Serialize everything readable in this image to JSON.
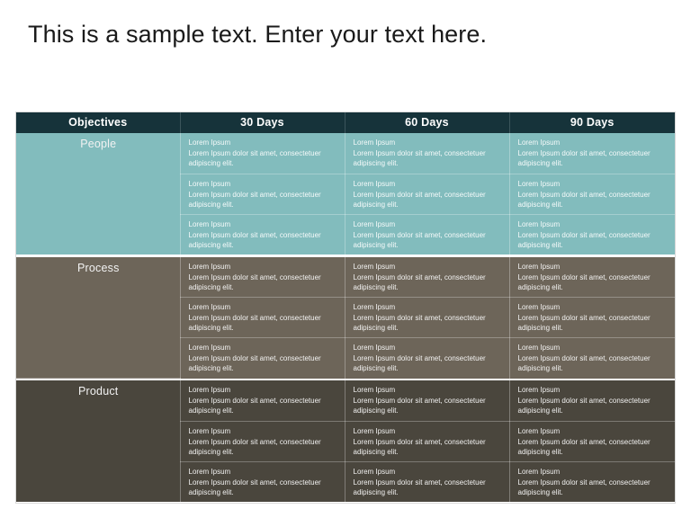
{
  "slide": {
    "title": "This is a sample text. Enter your text here."
  },
  "table": {
    "columns": [
      {
        "key": "objectives",
        "label": "Objectives"
      },
      {
        "key": "d30",
        "label": "30 Days"
      },
      {
        "key": "d60",
        "label": "60 Days"
      },
      {
        "key": "d90",
        "label": "90 Days"
      }
    ],
    "cell_text": {
      "head": "Lorem Ipsum",
      "body": "Lorem Ipsum dolor sit amet, consectetuer adipiscing elit."
    },
    "rows": [
      {
        "key": "people",
        "label": "People",
        "color": "#82bcbd",
        "subrows": [
          {
            "d30_head": "Lorem Ipsum",
            "d30_body": "Lorem Ipsum dolor sit amet, consectetuer adipiscing elit.",
            "d60_head": "Lorem Ipsum",
            "d60_body": "Lorem Ipsum dolor sit amet, consectetuer adipiscing elit.",
            "d90_head": "Lorem Ipsum",
            "d90_body": "Lorem Ipsum dolor sit amet, consectetuer adipiscing elit."
          },
          {
            "d30_head": "Lorem Ipsum",
            "d30_body": "Lorem Ipsum dolor sit amet, consectetuer adipiscing elit.",
            "d60_head": "Lorem Ipsum",
            "d60_body": "Lorem Ipsum dolor sit amet, consectetuer adipiscing elit.",
            "d90_head": "Lorem Ipsum",
            "d90_body": "Lorem Ipsum dolor sit amet, consectetuer adipiscing elit."
          },
          {
            "d30_head": "Lorem Ipsum",
            "d30_body": "Lorem Ipsum dolor sit amet, consectetuer adipiscing elit.",
            "d60_head": "Lorem Ipsum",
            "d60_body": "Lorem Ipsum dolor sit amet, consectetuer adipiscing elit.",
            "d90_head": "Lorem Ipsum",
            "d90_body": "Lorem Ipsum dolor sit amet, consectetuer adipiscing elit."
          }
        ]
      },
      {
        "key": "process",
        "label": "Process",
        "color": "#6d6559",
        "subrows": [
          {
            "d30_head": "Lorem Ipsum",
            "d30_body": "Lorem Ipsum dolor sit amet, consectetuer adipiscing elit.",
            "d60_head": "Lorem Ipsum",
            "d60_body": "Lorem Ipsum dolor sit amet, consectetuer adipiscing elit.",
            "d90_head": "Lorem Ipsum",
            "d90_body": "Lorem Ipsum dolor sit amet, consectetuer adipiscing elit."
          },
          {
            "d30_head": "Lorem Ipsum",
            "d30_body": "Lorem Ipsum dolor sit amet, consectetuer adipiscing elit.",
            "d60_head": "Lorem Ipsum",
            "d60_body": "Lorem Ipsum dolor sit amet, consectetuer adipiscing elit.",
            "d90_head": "Lorem Ipsum",
            "d90_body": "Lorem Ipsum dolor sit amet, consectetuer adipiscing elit."
          },
          {
            "d30_head": "Lorem Ipsum",
            "d30_body": "Lorem Ipsum dolor sit amet, consectetuer adipiscing elit.",
            "d60_head": "Lorem Ipsum",
            "d60_body": "Lorem Ipsum dolor sit amet, consectetuer adipiscing elit.",
            "d90_head": "Lorem Ipsum",
            "d90_body": "Lorem Ipsum dolor sit amet, consectetuer adipiscing elit."
          }
        ]
      },
      {
        "key": "product",
        "label": "Product",
        "color": "#4a463d",
        "subrows": [
          {
            "d30_head": "Lorem Ipsum",
            "d30_body": "Lorem Ipsum dolor sit amet, consectetuer adipiscing elit.",
            "d60_head": "Lorem Ipsum",
            "d60_body": "Lorem Ipsum dolor sit amet, consectetuer adipiscing elit.",
            "d90_head": "Lorem Ipsum",
            "d90_body": "Lorem Ipsum dolor sit amet, consectetuer adipiscing elit."
          },
          {
            "d30_head": "Lorem Ipsum",
            "d30_body": "Lorem Ipsum dolor sit amet, consectetuer adipiscing elit.",
            "d60_head": "Lorem Ipsum",
            "d60_body": "Lorem Ipsum dolor sit amet, consectetuer adipiscing elit.",
            "d90_head": "Lorem Ipsum",
            "d90_body": "Lorem Ipsum dolor sit amet, consectetuer adipiscing elit."
          },
          {
            "d30_head": "Lorem Ipsum",
            "d30_body": "Lorem Ipsum dolor sit amet, consectetuer adipiscing elit.",
            "d60_head": "Lorem Ipsum",
            "d60_body": "Lorem Ipsum dolor sit amet, consectetuer adipiscing elit.",
            "d90_head": "Lorem Ipsum",
            "d90_body": "Lorem Ipsum dolor sit amet, consectetuer adipiscing elit."
          }
        ]
      }
    ]
  },
  "theme": {
    "header_bg": "#16333a",
    "header_fg": "#ffffff",
    "slide_bg": "#ffffff",
    "title_color": "#1a1a1a"
  }
}
